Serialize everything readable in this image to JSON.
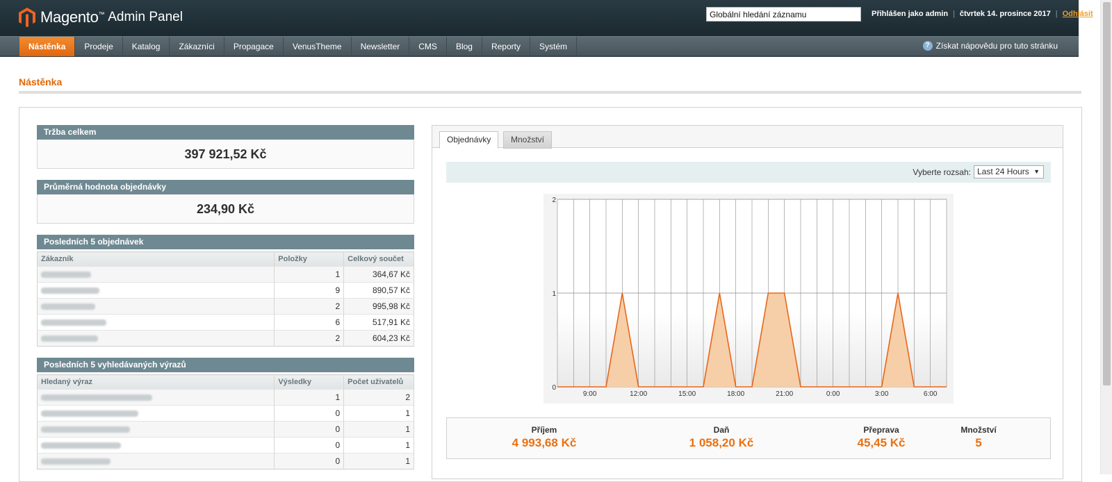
{
  "header": {
    "logo_brand": "Magento",
    "logo_tm": "™",
    "logo_sub": "Admin Panel",
    "search_value": "Globální hledání záznamu",
    "logged_in": "Přihlášen jako admin",
    "date": "čtvrtek 14. prosince 2017",
    "logout": "Odhlásit"
  },
  "nav": {
    "items": [
      "Nástěnka",
      "Prodeje",
      "Katalog",
      "Zákazníci",
      "Propagace",
      "VenusTheme",
      "Newsletter",
      "CMS",
      "Blog",
      "Reporty",
      "Systém"
    ],
    "help_label": "Získat nápovědu pro tuto stránku"
  },
  "page": {
    "title": "Nástěnka"
  },
  "lifetime_sales": {
    "title": "Tržba celkem",
    "value": "397 921,52 Kč"
  },
  "avg_order": {
    "title": "Průměrná hodnota objednávky",
    "value": "234,90 Kč"
  },
  "last_orders": {
    "title": "Posledních 5 objednávek",
    "columns": [
      "Zákazník",
      "Položky",
      "Celkový součet"
    ],
    "rows": [
      {
        "items": "1",
        "total": "364,67 Kč"
      },
      {
        "items": "9",
        "total": "890,57 Kč"
      },
      {
        "items": "2",
        "total": "995,98 Kč"
      },
      {
        "items": "6",
        "total": "517,91 Kč"
      },
      {
        "items": "2",
        "total": "604,23 Kč"
      }
    ]
  },
  "last_searches": {
    "title": "Posledních 5 vyhledávaných výrazů",
    "columns": [
      "Hledaný výraz",
      "Výsledky",
      "Počet uživatelů"
    ],
    "rows": [
      {
        "results": "1",
        "users": "2"
      },
      {
        "results": "0",
        "users": "1"
      },
      {
        "results": "0",
        "users": "1"
      },
      {
        "results": "0",
        "users": "1"
      },
      {
        "results": "0",
        "users": "1"
      }
    ]
  },
  "tabs": {
    "orders": "Objednávky",
    "amounts": "Množství"
  },
  "range": {
    "label": "Vyberte rozsah:",
    "selected": "Last 24 Hours"
  },
  "chart_data": {
    "type": "area",
    "x_ticks": [
      "9:00",
      "12:00",
      "15:00",
      "18:00",
      "21:00",
      "0:00",
      "3:00",
      "6:00"
    ],
    "y_ticks": [
      "0",
      "1",
      "2"
    ],
    "ylim": [
      0,
      2
    ],
    "x_hours": [
      7,
      8,
      9,
      10,
      11,
      12,
      13,
      14,
      15,
      16,
      17,
      18,
      19,
      20,
      21,
      22,
      23,
      24,
      25,
      26,
      27,
      28,
      29,
      30
    ],
    "values": [
      0,
      0,
      0,
      0,
      1,
      0,
      0,
      0,
      0,
      0,
      1,
      0,
      0,
      1,
      1,
      0,
      0,
      0,
      0,
      0,
      0,
      1,
      0,
      0
    ],
    "line_color": "#e8661a",
    "fill_color": "#f6cfa8"
  },
  "totals": [
    {
      "label": "Příjem",
      "value": "4 993,68 Kč"
    },
    {
      "label": "Daň",
      "value": "1 058,20 Kč"
    },
    {
      "label": "Přeprava",
      "value": "45,45 Kč"
    },
    {
      "label": "Množství",
      "value": "5"
    }
  ]
}
